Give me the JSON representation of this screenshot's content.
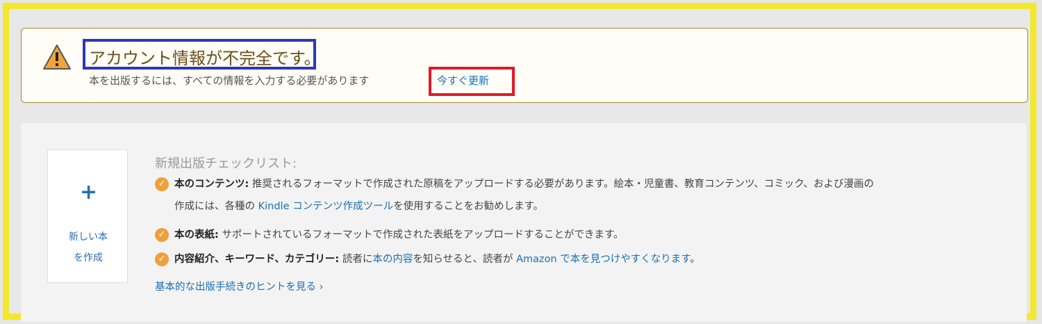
{
  "alert": {
    "title": "アカウント情報が不完全です。",
    "message": "本を出版するには、すべての情報を入力する必要があります",
    "update_link": "今すぐ更新"
  },
  "create_card": {
    "plus": "+",
    "label_line1": "新しい本",
    "label_line2": "を作成"
  },
  "checklist": {
    "title": "新規出版チェックリスト:",
    "items": [
      {
        "heading": "本のコンテンツ:",
        "text1": " 推奨されるフォーマットで作成された原稿をアップロードする必要があります。絵本・児童書、教育コンテンツ、コミック、および漫画の",
        "text2_pre": "作成には、各種の ",
        "link": "Kindle コンテンツ作成ツール",
        "text2_post": "を使用することをお勧めします。"
      },
      {
        "heading": "本の表紙:",
        "text1": " サポートされているフォーマットで作成された表紙をアップロードすることができます。"
      },
      {
        "heading": "内容紹介、キーワード、カテゴリー:",
        "text_pre": " 読者に",
        "link1": "本の内容",
        "text_mid": "を知らせると、読者が ",
        "link2": "Amazon で本を見つけやすくなります",
        "text_post": "。"
      }
    ],
    "hint_link": "基本的な出版手続きのヒントを見る ›"
  },
  "colors": {
    "frame_highlight": "#f2e82c",
    "title_highlight": "#2d37b4",
    "link_highlight": "#e01a2a",
    "link": "#1a6fb3",
    "check": "#f0a03a"
  }
}
